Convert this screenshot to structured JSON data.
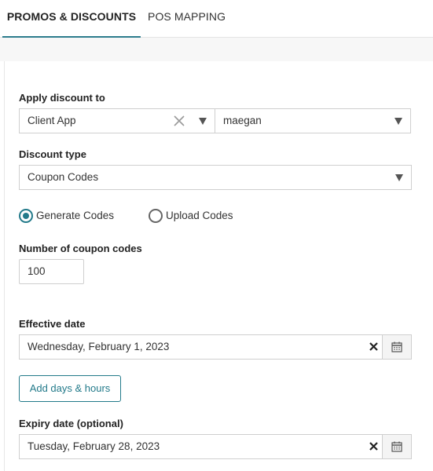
{
  "tabs": [
    {
      "label": "PROMOS & DISCOUNTS",
      "active": true
    },
    {
      "label": "POS MAPPING",
      "active": false
    }
  ],
  "apply_discount": {
    "label": "Apply discount to",
    "target_value": "Client App",
    "client_value": "maegan"
  },
  "discount_type": {
    "label": "Discount type",
    "value": "Coupon Codes"
  },
  "code_mode": {
    "options": [
      {
        "label": "Generate Codes",
        "selected": true
      },
      {
        "label": "Upload Codes",
        "selected": false
      }
    ]
  },
  "coupon_count": {
    "label": "Number of coupon codes",
    "value": "100"
  },
  "effective_date": {
    "label": "Effective date",
    "value": "Wednesday, February 1, 2023"
  },
  "add_days_hours": {
    "label": "Add days & hours"
  },
  "expiry_date": {
    "label": "Expiry date (optional)",
    "value": "Tuesday, February 28, 2023"
  },
  "icons": {
    "clear": "clear-icon",
    "dropdown": "chevron-down-icon",
    "calendar": "calendar-icon"
  },
  "colors": {
    "accent": "#237a8a"
  }
}
